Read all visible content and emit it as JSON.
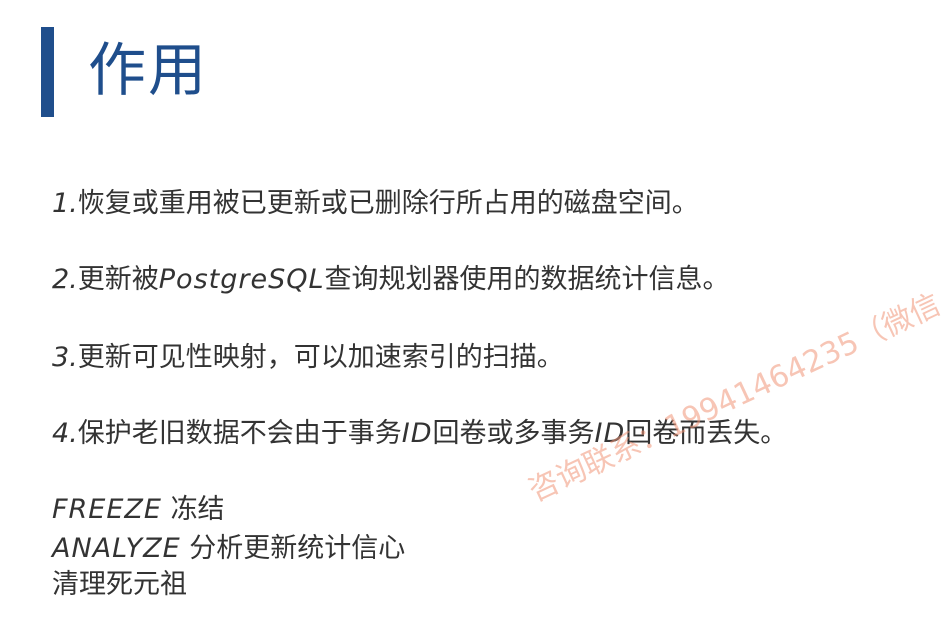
{
  "slide": {
    "title": "作用",
    "items": [
      {
        "num": "1.",
        "text": "恢复或重用被已更新或已删除行所占用的磁盘空间。"
      },
      {
        "num": "2.",
        "pre": "更新被",
        "italic": "PostgreSQL",
        "post": "查询规划器使用的数据统计信息。"
      },
      {
        "num": "3.",
        "text": "更新可见性映射，可以加速索引的扫描。"
      },
      {
        "num": "4.",
        "pre": "保护老旧数据不会由于事务",
        "italic": "ID",
        "mid": "回卷或多事务",
        "italic2": "ID",
        "post": "回卷而丢失。"
      }
    ],
    "notes": [
      {
        "keyword": "FREEZE",
        "text": "冻结"
      },
      {
        "keyword": "ANALYZE",
        "text": "分析更新统计信心"
      },
      {
        "keyword": "",
        "text": "清理死元祖"
      }
    ],
    "watermark": "咨询联系：19941464235（微信"
  },
  "colors": {
    "accent": "#1f4e8c",
    "text": "#333333",
    "watermark": "#f09678"
  }
}
